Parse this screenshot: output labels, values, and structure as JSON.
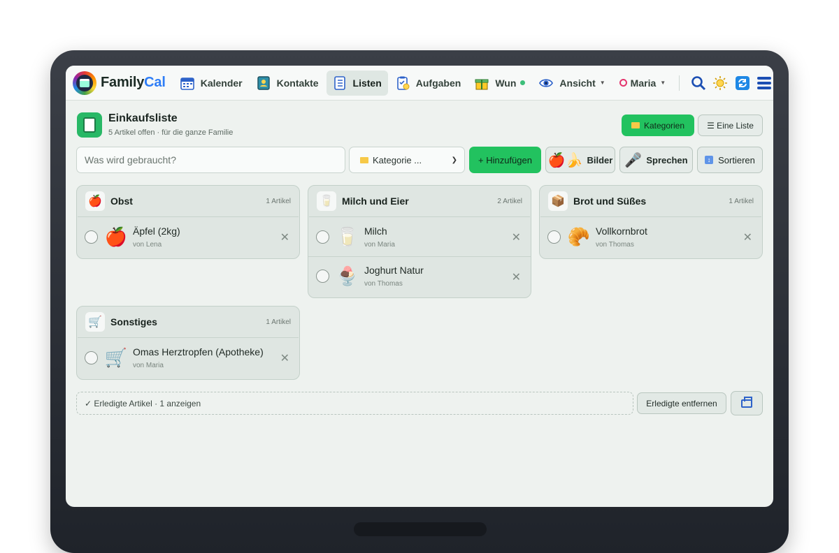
{
  "nav": {
    "brand_part1": "Family",
    "brand_part2": "Cal",
    "items": [
      {
        "label": "Kalender",
        "icon": "calendar-icon"
      },
      {
        "label": "Kontakte",
        "icon": "contacts-icon"
      },
      {
        "label": "Listen",
        "icon": "list-icon",
        "active": true
      },
      {
        "label": "Aufgaben",
        "icon": "tasks-icon"
      },
      {
        "label": "Wun",
        "icon": "gift-icon"
      },
      {
        "label": "Ansicht",
        "icon": "eye-icon"
      }
    ],
    "user": "Maria",
    "right_icons": [
      "search-icon",
      "sun-icon",
      "sync-icon",
      "menu-icon"
    ]
  },
  "header": {
    "title": "Einkaufsliste",
    "subtitle": "5 Artikel offen · für die ganze Familie",
    "kategorien_label": "Kategorien",
    "eine_liste_label": "☰ Eine Liste"
  },
  "add_row": {
    "placeholder": "Was wird gebraucht?",
    "category_select": "Kategorie ...",
    "add_label": "+ Hinzufügen",
    "bilder_label": "Bilder",
    "sprechen_label": "Sprechen",
    "sortieren_label": "Sortieren"
  },
  "categories": [
    {
      "name": "Obst",
      "count": "1 Artikel",
      "icon": "🍎",
      "items": [
        {
          "name": "Äpfel (2kg)",
          "by": "von Lena",
          "emoji": "🍎"
        }
      ]
    },
    {
      "name": "Milch und Eier",
      "count": "2 Artikel",
      "icon": "🥛",
      "items": [
        {
          "name": "Milch",
          "by": "von Maria",
          "emoji": "🥛"
        },
        {
          "name": "Joghurt Natur",
          "by": "von Thomas",
          "emoji": "🍨"
        }
      ]
    },
    {
      "name": "Brot und Süßes",
      "count": "1 Artikel",
      "icon": "📦",
      "items": [
        {
          "name": "Vollkornbrot",
          "by": "von Thomas",
          "emoji": "🥐"
        }
      ]
    },
    {
      "name": "Sonstiges",
      "count": "1 Artikel",
      "icon": "🛒",
      "items": [
        {
          "name": "Omas Herztropfen (Apotheke)",
          "by": "von Maria",
          "emoji": "🛒"
        }
      ]
    }
  ],
  "footer": {
    "done_label": "✓ Erledigte Artikel · 1 anzeigen",
    "remove_label": "Erledigte entfernen"
  },
  "colors": {
    "accent_green": "#22c25f",
    "brand_blue": "#2e7df6"
  }
}
